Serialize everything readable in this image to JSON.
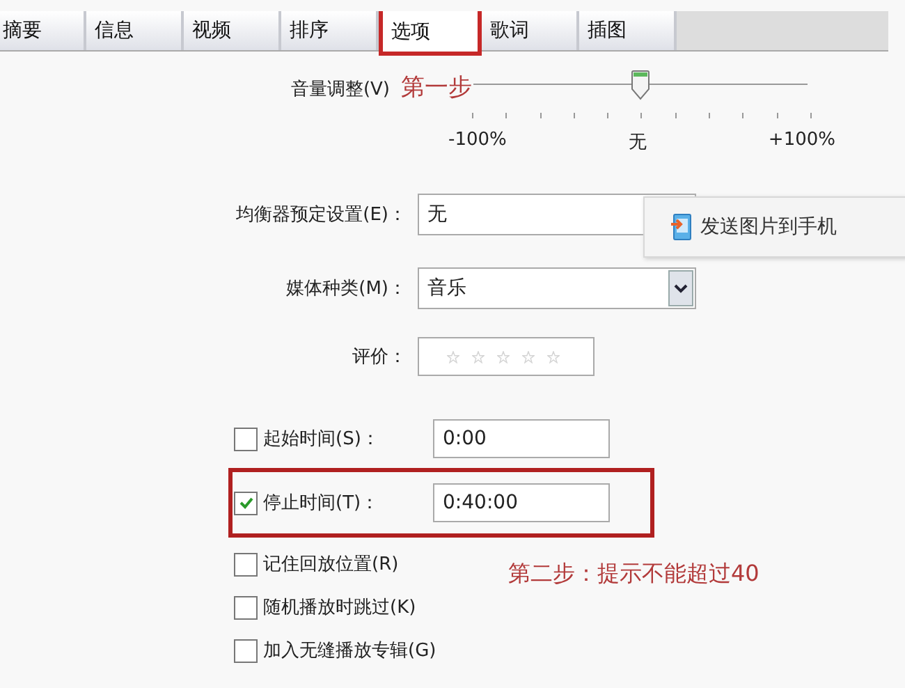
{
  "tabs": [
    {
      "label": "摘要",
      "selected": false
    },
    {
      "label": "信息",
      "selected": false
    },
    {
      "label": "视频",
      "selected": false
    },
    {
      "label": "排序",
      "selected": false
    },
    {
      "label": "选项",
      "selected": true
    },
    {
      "label": "歌词",
      "selected": false
    },
    {
      "label": "插图",
      "selected": false
    }
  ],
  "volume": {
    "label": "音量调整(V)",
    "annotation": "第一步",
    "level": 0.5,
    "scale": [
      "-100%",
      "无",
      "+100%"
    ]
  },
  "equalizer": {
    "label": "均衡器预定设置(E)：",
    "value": "无"
  },
  "popup_menu": {
    "item": "发送图片到手机"
  },
  "media_type": {
    "label": "媒体种类(M)：",
    "value": "音乐"
  },
  "rating": {
    "label": "评价：",
    "stars": 0
  },
  "start_time": {
    "label": "起始时间(S)：",
    "checked": false,
    "value": "0:00"
  },
  "stop_time": {
    "label": "停止时间(T)：",
    "checked": true,
    "value": "0:40:00",
    "highlighted": true
  },
  "note": "第二步：提示不能超过40",
  "options": [
    {
      "label": "记住回放位置(R)",
      "checked": false
    },
    {
      "label": "随机播放时跳过(K)",
      "checked": false
    },
    {
      "label": "加入无缝播放专辑(G)",
      "checked": false
    }
  ]
}
